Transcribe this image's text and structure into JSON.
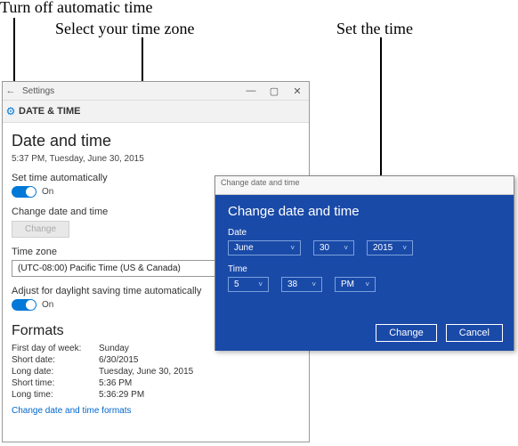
{
  "annotations": {
    "a1": "Turn off automatic time",
    "a2": "Select your time zone",
    "a3": "Set the time"
  },
  "settings": {
    "window_title": "Settings",
    "category": "DATE & TIME",
    "heading": "Date and time",
    "current_datetime": "5:37 PM, Tuesday, June 30, 2015",
    "auto_time_label": "Set time automatically",
    "auto_time_state": "On",
    "change_dt_label": "Change date and time",
    "change_btn": "Change",
    "tz_label": "Time zone",
    "tz_value": "(UTC-08:00) Pacific Time (US & Canada)",
    "dst_label": "Adjust for daylight saving time automatically",
    "dst_state": "On",
    "formats_heading": "Formats",
    "formats": {
      "first_day_label": "First day of week:",
      "first_day": "Sunday",
      "short_date_label": "Short date:",
      "short_date": "6/30/2015",
      "long_date_label": "Long date:",
      "long_date": "Tuesday, June 30, 2015",
      "short_time_label": "Short time:",
      "short_time": "5:36 PM",
      "long_time_label": "Long time:",
      "long_time": "5:36:29 PM"
    },
    "formats_link": "Change date and time formats"
  },
  "dialog": {
    "titlebar": "Change date and time",
    "heading": "Change date and time",
    "date_label": "Date",
    "month": "June",
    "day": "30",
    "year": "2015",
    "time_label": "Time",
    "hour": "5",
    "minute": "38",
    "ampm": "PM",
    "change_btn": "Change",
    "cancel_btn": "Cancel"
  }
}
